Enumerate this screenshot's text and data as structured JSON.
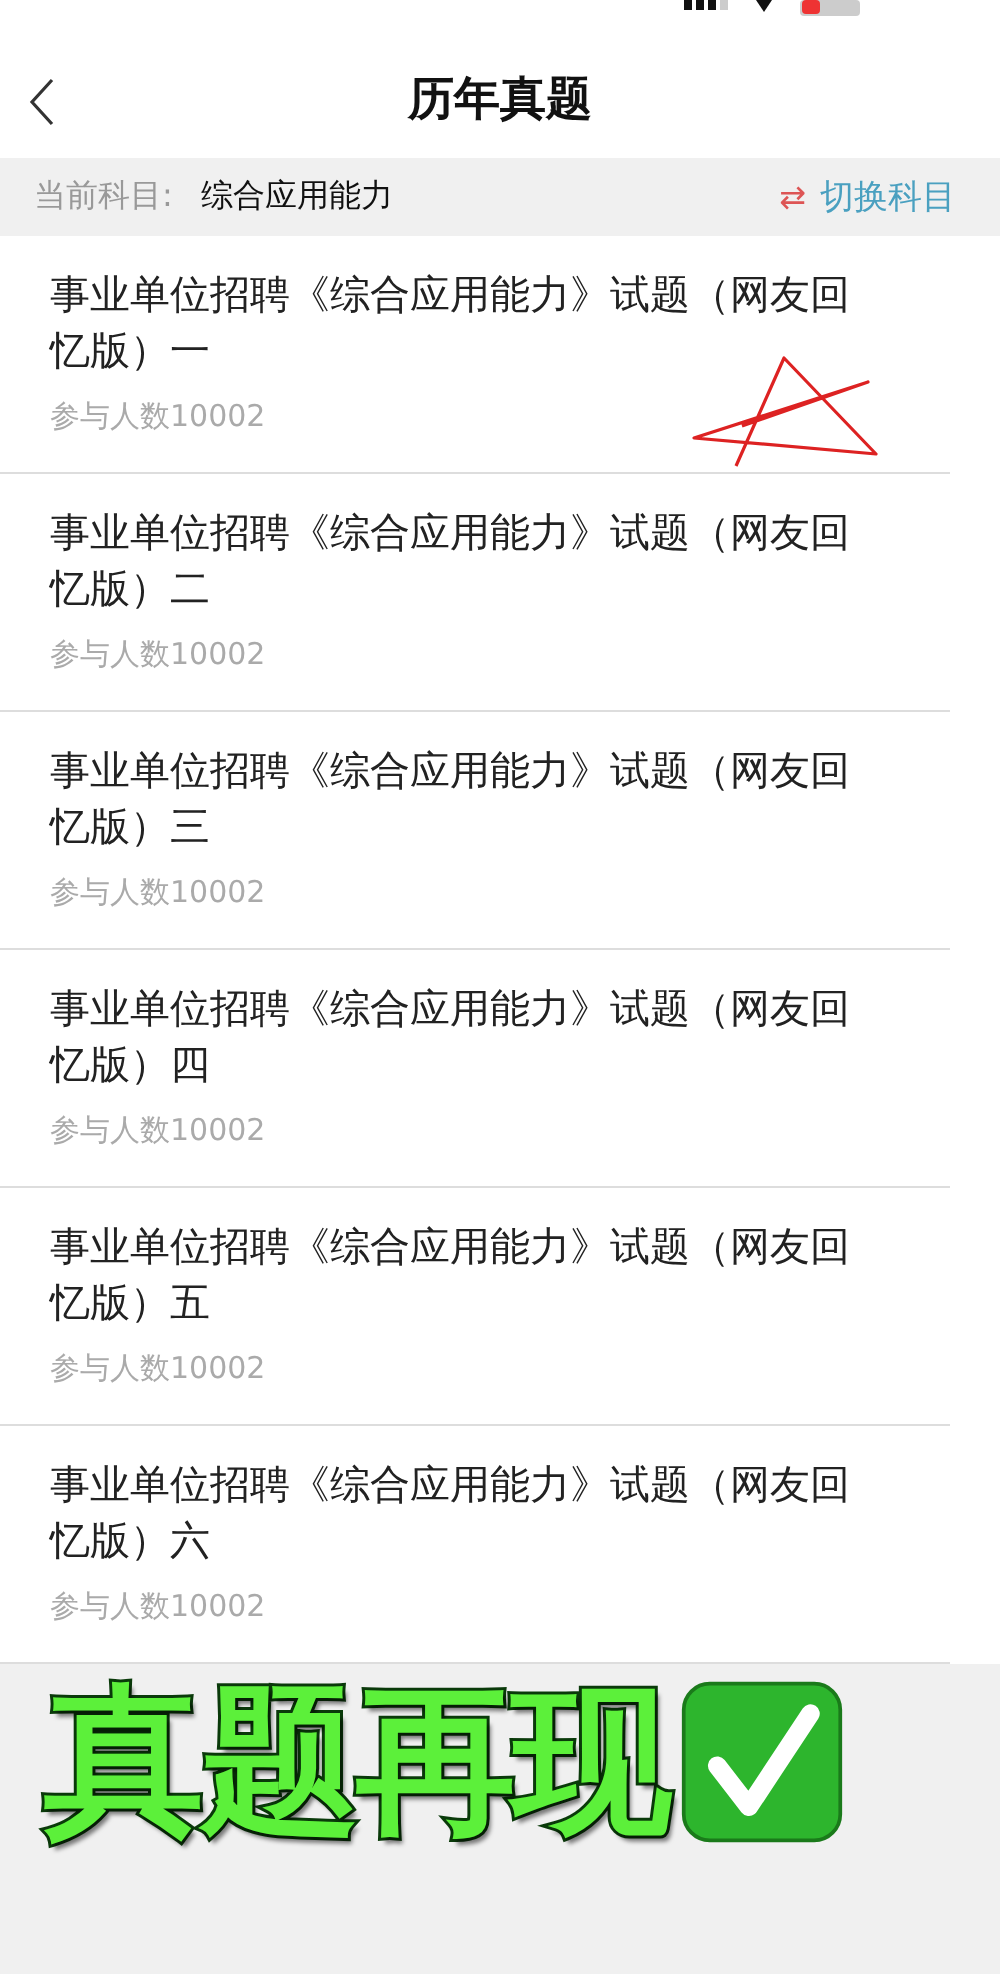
{
  "nav": {
    "title": "历年真题"
  },
  "subject_bar": {
    "label": "当前科目:",
    "value": "综合应用能力",
    "switch_icon": "⇄",
    "switch_label": "切换科目"
  },
  "papers": [
    {
      "title": "事业单位招聘《综合应用能力》试题（网友回忆版）一",
      "participants": "参与人数10002",
      "starred": true
    },
    {
      "title": "事业单位招聘《综合应用能力》试题（网友回忆版）二",
      "participants": "参与人数10002",
      "starred": false
    },
    {
      "title": "事业单位招聘《综合应用能力》试题（网友回忆版）三",
      "participants": "参与人数10002",
      "starred": false
    },
    {
      "title": "事业单位招聘《综合应用能力》试题（网友回忆版）四",
      "participants": "参与人数10002",
      "starred": false
    },
    {
      "title": "事业单位招聘《综合应用能力》试题（网友回忆版）五",
      "participants": "参与人数10002",
      "starred": false
    },
    {
      "title": "事业单位招聘《综合应用能力》试题（网友回忆版）六",
      "participants": "参与人数10002",
      "starred": false
    }
  ],
  "overlay": {
    "caption": "真题再现"
  }
}
